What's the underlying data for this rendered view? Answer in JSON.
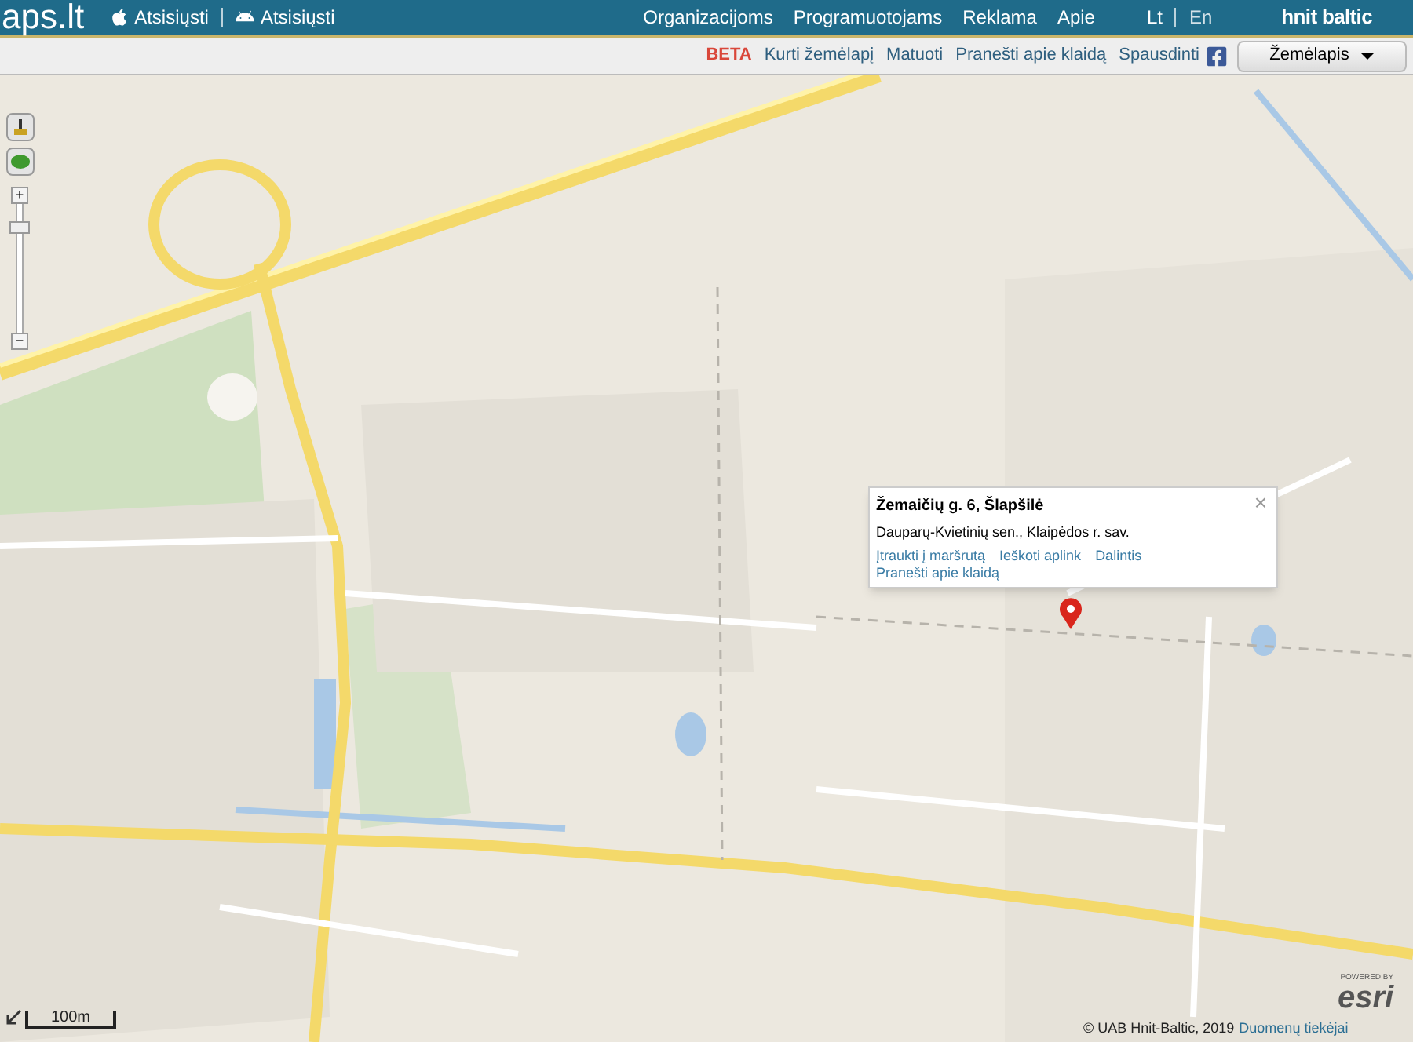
{
  "header": {
    "logo": "aps.lt",
    "apps": [
      {
        "kind": "apple",
        "label": "Atsisiųsti"
      },
      {
        "kind": "android",
        "label": "Atsisiųsti"
      }
    ],
    "nav": [
      "Organizacijoms",
      "Programuotojams",
      "Reklama",
      "Apie"
    ],
    "languages": [
      {
        "label": "Lt",
        "selected": true
      },
      {
        "label": "En",
        "selected": false
      }
    ],
    "brand": "hnit baltic"
  },
  "toolbar": {
    "badge": "BETA",
    "links": [
      "Kurti žemėlapį",
      "Matuoti",
      "Pranešti apie klaidą",
      "Spausdinti"
    ],
    "dropdown": "Žemėlapis"
  },
  "map": {
    "zoom": {
      "plus": "+",
      "minus": "−",
      "level": 0.85
    },
    "popup": {
      "title": "Žemaičių g. 6, Šlapšilė",
      "subtitle": "Dauparų-Kvietinių sen., Klaipėdos r. sav.",
      "close": "×",
      "links": [
        "Įtraukti į maršrutą",
        "Ieškoti aplink",
        "Dalintis",
        "Pranešti apie klaidą"
      ]
    },
    "scale": "100m",
    "attribution": {
      "text": "© UAB Hnit-Baltic, 2019",
      "link": "Duomenų tiekėjai"
    },
    "esri": {
      "small": "POWERED BY",
      "logo": "esri"
    }
  }
}
